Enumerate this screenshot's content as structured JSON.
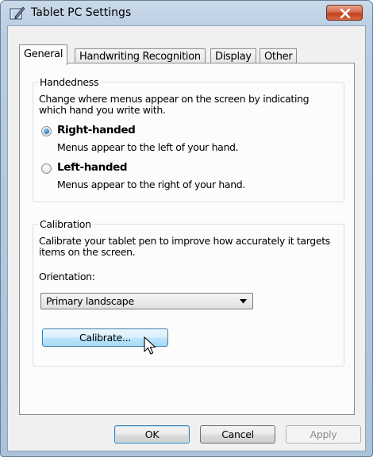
{
  "window": {
    "title": "Tablet PC Settings",
    "icon": "pen-tablet-icon",
    "close_icon": "close-icon"
  },
  "tabs": [
    {
      "label": "General",
      "active": true
    },
    {
      "label": "Handwriting Recognition",
      "active": false
    },
    {
      "label": "Display",
      "active": false
    },
    {
      "label": "Other",
      "active": false
    }
  ],
  "handedness": {
    "group_label": "Handedness",
    "description": "Change where menus appear on the screen by indicating which hand you write with.",
    "description_line1": "Change where menus appear on the screen by indicating",
    "description_line2": "which hand you write with.",
    "options": [
      {
        "label": "Right-handed",
        "sub": "Menus appear to the left of your hand.",
        "selected": true
      },
      {
        "label": "Left-handed",
        "sub": "Menus appear to the right of your hand.",
        "selected": false
      }
    ]
  },
  "calibration": {
    "group_label": "Calibration",
    "description_line1": "Calibrate your tablet pen to improve how accurately it targets",
    "description_line2": "items on the screen.",
    "orientation_label": "Orientation:",
    "orientation_value": "Primary landscape",
    "calibrate_button": "Calibrate..."
  },
  "footer": {
    "ok": "OK",
    "cancel": "Cancel",
    "apply": "Apply"
  },
  "colors": {
    "accent": "#3c7fb1",
    "close_button": "#c2421f",
    "radio_selected": "#1c5a9a"
  }
}
